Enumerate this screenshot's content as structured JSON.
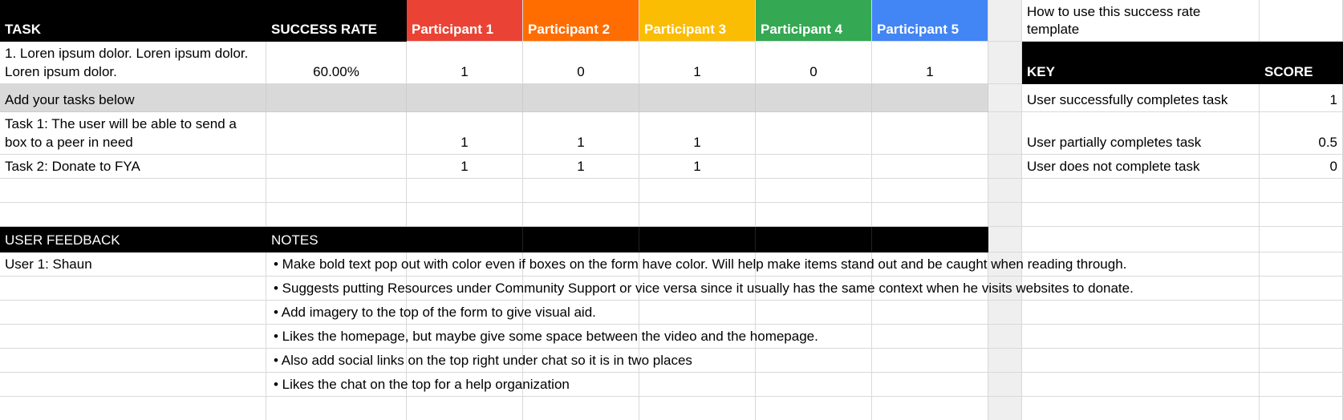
{
  "colors": {
    "header_bg": "#000000",
    "participant_colors": [
      "#ea4335",
      "#ff6d01",
      "#fbbc04",
      "#34a853",
      "#4285f4"
    ],
    "section_gray": "#d9d9d9",
    "gridline": "#d9d9d9"
  },
  "header": {
    "task": "TASK",
    "success_rate": "SUCCESS RATE",
    "participants": [
      "Participant 1",
      "Participant 2",
      "Participant 3",
      "Participant 4",
      "Participant 5"
    ]
  },
  "rows": {
    "example": {
      "task": "1. Loren ipsum dolor.  Loren ipsum dolor.  Loren ipsum dolor.",
      "success_rate": "60.00%",
      "scores": [
        "1",
        "0",
        "1",
        "0",
        "1"
      ]
    },
    "add_tasks_label": "Add your tasks below",
    "task1": {
      "task": "Task 1: The user will be able to send a box to a peer in need",
      "scores": [
        "1",
        "1",
        "1",
        "",
        ""
      ]
    },
    "task2": {
      "task": "Task 2: Donate to FYA",
      "scores": [
        "1",
        "1",
        "1",
        "",
        ""
      ]
    }
  },
  "key_panel": {
    "how_to": "How to use this success rate template",
    "key_header": "KEY",
    "score_header": "SCORE",
    "items": [
      {
        "label": "User successfully completes task",
        "score": "1"
      },
      {
        "label": "User partially completes task",
        "score": "0.5"
      },
      {
        "label": "User does not complete task",
        "score": "0"
      }
    ]
  },
  "feedback": {
    "header": "USER FEEDBACK",
    "notes_header": "NOTES",
    "user": "User 1: Shaun",
    "notes": [
      "• Make bold text pop out with color even if boxes on the form have color. Will help make items stand out and be caught when reading through.",
      "• Suggests putting Resources under Community Support or vice versa since it usually has the same context when he visits websites to donate.",
      "• Add imagery to the top of the form to give visual aid.",
      "• Likes the homepage, but maybe give some space between the video and the homepage.",
      "• Also add social links on the top right under chat so it is in two places",
      "• Likes the chat on the top for a help organization"
    ]
  }
}
